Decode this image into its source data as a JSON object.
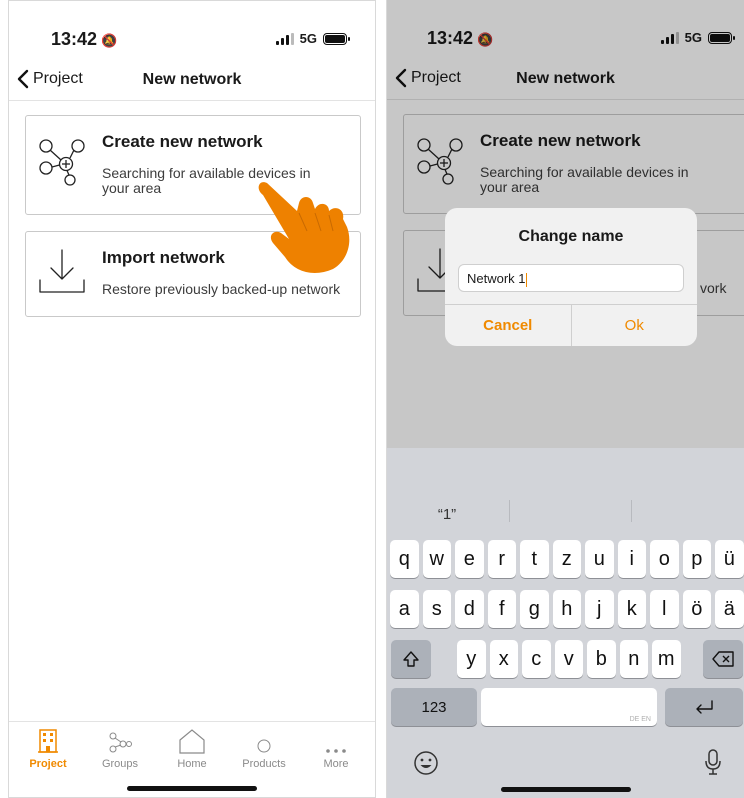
{
  "status": {
    "time": "13:42",
    "network": "5G"
  },
  "nav": {
    "back_label": "Project",
    "title": "New network"
  },
  "left": {
    "create": {
      "title": "Create new network",
      "subtitle_line1": "Searching for available devices in",
      "subtitle_line2": "your area"
    },
    "import": {
      "title": "Import network",
      "subtitle": "Restore previously backed-up network"
    },
    "tabs": [
      {
        "label": "Project",
        "icon": "building-icon",
        "active": true
      },
      {
        "label": "Groups",
        "icon": "groups-icon",
        "active": false
      },
      {
        "label": "Home",
        "icon": "home-icon",
        "active": false
      },
      {
        "label": "Products",
        "icon": "circle-icon",
        "active": false
      },
      {
        "label": "More",
        "icon": "more-icon",
        "active": false
      }
    ]
  },
  "right": {
    "create_title": "Create new network",
    "create_subtitle_line1": "Searching for available devices in",
    "create_subtitle_line2": "your area",
    "import_tail": "vork",
    "dialog": {
      "title": "Change name",
      "input_value": "Network 1",
      "cancel_label": "Cancel",
      "ok_label": "Ok"
    },
    "keyboard": {
      "suggestion": "“1”",
      "row1": [
        "q",
        "w",
        "e",
        "r",
        "t",
        "z",
        "u",
        "i",
        "o",
        "p",
        "ü"
      ],
      "row2": [
        "a",
        "s",
        "d",
        "f",
        "g",
        "h",
        "j",
        "k",
        "l",
        "ö",
        "ä"
      ],
      "row3": [
        "y",
        "x",
        "c",
        "v",
        "b",
        "n",
        "m"
      ],
      "numbers_label": "123",
      "space_hint": "DE EN"
    }
  },
  "colors": {
    "accent": "#f08a00",
    "keyboard_bg": "#d2d4d9"
  }
}
